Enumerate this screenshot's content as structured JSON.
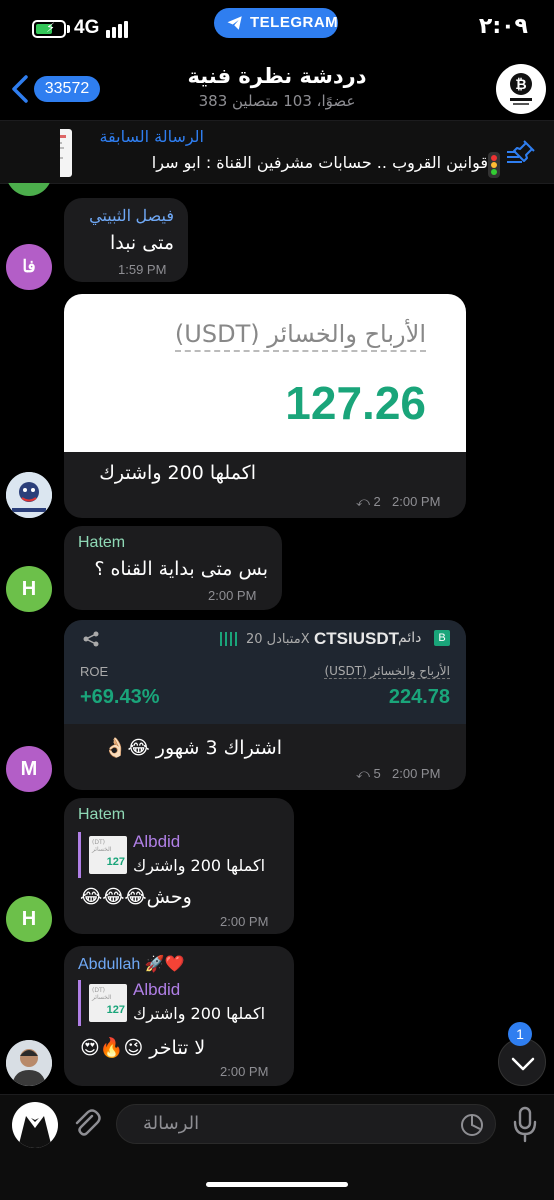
{
  "status_bar": {
    "network": "4G",
    "app_pill": "TELEGRAM",
    "time": "٢:٠٩"
  },
  "header": {
    "back_count": "33572",
    "title": "دردشة نظرة فنية",
    "subtitle": "383 عضوًا، 103 متصلين"
  },
  "pinned": {
    "label": "الرسالة السابقة",
    "text": "قوانين القروب .. حسابات مشرفين القناة : ابو سرا"
  },
  "messages": [
    {
      "sender": "فيصل الثبيتي",
      "text": "متى نبدا",
      "time": "1:59 PM",
      "avatar_initials": "فا"
    },
    {
      "card_title": "الأرباح والخسائر (USDT)",
      "card_value": "127.26",
      "text": "اكملها 200 واشترك",
      "forwards": "2",
      "time": "2:00 PM"
    },
    {
      "sender": "Hatem",
      "text": "بس متى بداية القناه ؟",
      "time": "2:00 PM",
      "avatar_initials": "H"
    },
    {
      "card_pair": "CTSIUSDT",
      "card_perp": "دائم",
      "card_cross": "متبادل 20X",
      "card_roe_label": "ROE",
      "card_roe": "+69.43%",
      "card_pnl_label": "الأرباح والخسائر (USDT)",
      "card_pnl": "224.78",
      "text": "اشتراك 3 شهور 😂👌🏻",
      "forwards": "5",
      "time": "2:00 PM",
      "avatar_initials": "M"
    },
    {
      "sender": "Hatem",
      "reply_name": "Albdid",
      "reply_text": "اكملها 200 واشترك",
      "text": "وحش😂😂😂",
      "time": "2:00 PM",
      "avatar_initials": "H"
    },
    {
      "sender": "Abdullah 🚀❤️",
      "reply_name": "Albdid",
      "reply_text": "اكملها 200 واشترك",
      "text": "لا تتاخر 😉🔥😍",
      "time": "2:00 PM"
    }
  ],
  "scroll_badge": "1",
  "input": {
    "placeholder": "الرسالة"
  },
  "colors": {
    "accent": "#2f7ef0",
    "bubble": "#1c1c1e",
    "green_value": "#1aa57a",
    "hatem": "#8fd9b6",
    "albdid": "#b07fe6",
    "faisal": "#6fa8f5"
  }
}
